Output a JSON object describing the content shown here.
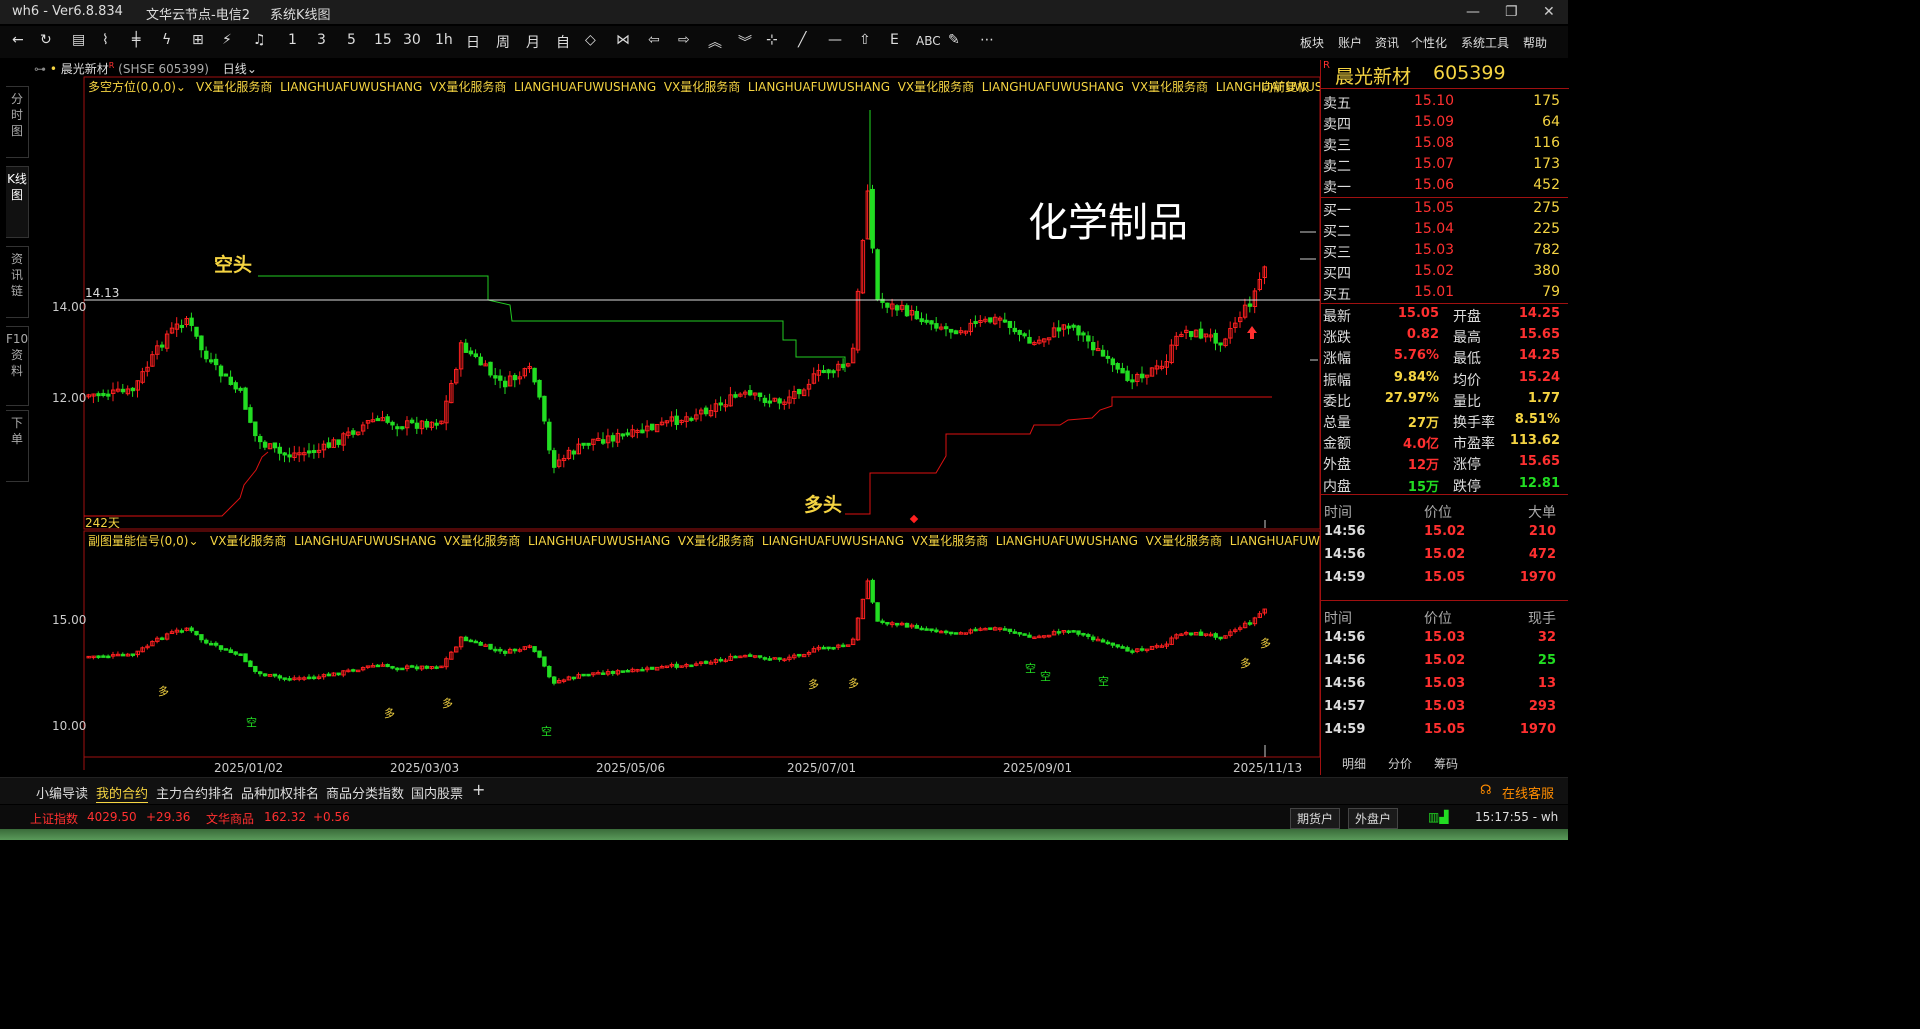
{
  "titlebar": {
    "app": "wh6 - Ver6.8.834",
    "server": "文华云节点-电信2",
    "view": "系统K线图"
  },
  "toolbar": {
    "nums": [
      "1",
      "3",
      "5",
      "15",
      "30",
      "1h",
      "日",
      "周",
      "月",
      "自"
    ],
    "abc": "ABC",
    "menus": [
      "板块",
      "账户",
      "资讯",
      "个性化",
      "系统工具",
      "帮助"
    ]
  },
  "lefttabs": [
    "分时图",
    "K线图",
    "资讯链",
    "F10资料",
    "下单"
  ],
  "secbar": {
    "name": "晨光新材",
    "code": "(SHSE 605399)",
    "period": "日线"
  },
  "main": {
    "indicator": "多空方位(0,0,0)",
    "ads": [
      "VX量化服务商",
      "LIANGHUAFUWUSHANG",
      "VX量化服务商",
      "LIANGHUAFUWUSHANG",
      "VX量化服务商",
      "LIANGHUAFUWUSHANG",
      "VX量化服务商",
      "LIANGHUAFUWUSHANG",
      "VX量化服务商",
      "LIANGHUAFUWUSHANG"
    ],
    "restore": "向前复权",
    "sector": "化学制品",
    "bear": "空头",
    "bull": "多头",
    "level": "14.13",
    "days": "242天",
    "yticks": [
      "14.00",
      "12.00"
    ]
  },
  "sub": {
    "indicator": "副图量能信号(0,0)",
    "ads": [
      "VX量化服务商",
      "LIANGHUAFUWUSHANG",
      "VX量化服务商",
      "LIANGHUAFUWUSHANG",
      "VX量化服务商",
      "LIANGHUAFUWUSHANG",
      "VX量化服务商",
      "LIANGHUAFUWUSHANG",
      "VX量化服务商",
      "LIANGHUAFUWUSHANG"
    ],
    "yticks": [
      "15.00",
      "10.00"
    ],
    "duo": "多",
    "kong": "空"
  },
  "xaxis": [
    "2025/01/02",
    "2025/03/03",
    "2025/05/06",
    "2025/07/01",
    "2025/09/01",
    "2025/11/13"
  ],
  "quote": {
    "header": {
      "name": "晨光新材",
      "code": "605399",
      "tag": "R"
    },
    "asks": [
      {
        "l": "卖五",
        "p": "15.10",
        "v": "175"
      },
      {
        "l": "卖四",
        "p": "15.09",
        "v": "64"
      },
      {
        "l": "卖三",
        "p": "15.08",
        "v": "116"
      },
      {
        "l": "卖二",
        "p": "15.07",
        "v": "173"
      },
      {
        "l": "卖一",
        "p": "15.06",
        "v": "452"
      }
    ],
    "bids": [
      {
        "l": "买一",
        "p": "15.05",
        "v": "275"
      },
      {
        "l": "买二",
        "p": "15.04",
        "v": "225"
      },
      {
        "l": "买三",
        "p": "15.03",
        "v": "782"
      },
      {
        "l": "买四",
        "p": "15.02",
        "v": "380"
      },
      {
        "l": "买五",
        "p": "15.01",
        "v": "79"
      }
    ],
    "stats": [
      {
        "l1": "最新",
        "v1": "15.05",
        "c1": "#ff3030",
        "l2": "开盘",
        "v2": "14.25",
        "c2": "#ff3030"
      },
      {
        "l1": "涨跌",
        "v1": "0.82",
        "c1": "#ff3030",
        "l2": "最高",
        "v2": "15.65",
        "c2": "#ff3030"
      },
      {
        "l1": "涨幅",
        "v1": "5.76%",
        "c1": "#ff3030",
        "l2": "最低",
        "v2": "14.25",
        "c2": "#ff3030"
      },
      {
        "l1": "振幅",
        "v1": "9.84%",
        "c1": "#f5d442",
        "l2": "均价",
        "v2": "15.24",
        "c2": "#ff3030"
      },
      {
        "l1": "委比",
        "v1": "27.97%",
        "c1": "#f5d442",
        "l2": "量比",
        "v2": "1.77",
        "c2": "#f5d442"
      },
      {
        "l1": "总量",
        "v1": "27万",
        "c1": "#f5d442",
        "l2": "换手率",
        "v2": "8.51%",
        "c2": "#f5d442"
      },
      {
        "l1": "金额",
        "v1": "4.0亿",
        "c1": "#ff3030",
        "l2": "市盈率",
        "v2": "113.62",
        "c2": "#f5d442"
      },
      {
        "l1": "外盘",
        "v1": "12万",
        "c1": "#ff3030",
        "l2": "涨停",
        "v2": "15.65",
        "c2": "#ff3030"
      },
      {
        "l1": "内盘",
        "v1": "15万",
        "c1": "#22dd22",
        "l2": "跌停",
        "v2": "12.81",
        "c2": "#22dd22"
      }
    ],
    "trades1": {
      "h": [
        "时间",
        "价位",
        "大单"
      ],
      "rows": [
        [
          "14:56",
          "15.02",
          "210"
        ],
        [
          "14:56",
          "15.02",
          "472"
        ],
        [
          "14:59",
          "15.05",
          "1970"
        ]
      ]
    },
    "trades2": {
      "h": [
        "时间",
        "价位",
        "现手"
      ],
      "rows": [
        [
          "14:56",
          "15.03",
          "32"
        ],
        [
          "14:56",
          "15.02",
          "25"
        ],
        [
          "14:56",
          "15.03",
          "13"
        ],
        [
          "14:57",
          "15.03",
          "293"
        ],
        [
          "14:59",
          "15.05",
          "1970"
        ]
      ],
      "colors": [
        "#ff3030",
        "#22dd22",
        "#ff3030",
        "#ff3030",
        "#ff3030"
      ]
    },
    "tabs": [
      "明细",
      "分价",
      "筹码"
    ]
  },
  "bottombar": {
    "items": [
      "小编导读",
      "我的合约",
      "主力合约排名",
      "品种加权排名",
      "商品分类指数",
      "国内股票"
    ],
    "service": "在线客服"
  },
  "statusbar": {
    "idx1": "上证指数",
    "v1": "4029.50",
    "c1": "+29.36",
    "idx2": "文华商品",
    "v2": "162.32",
    "c2": "+0.56",
    "b1": "期货户",
    "b2": "外盘户",
    "time": "15:17:55 - wh"
  },
  "chart_data": {
    "type": "candlestick",
    "ylim_main": [
      9.5,
      15.7
    ],
    "ylim_sub": [
      9.5,
      15.7
    ],
    "last": 15.05,
    "high": 15.65,
    "low": 14.25,
    "open": 14.25
  }
}
